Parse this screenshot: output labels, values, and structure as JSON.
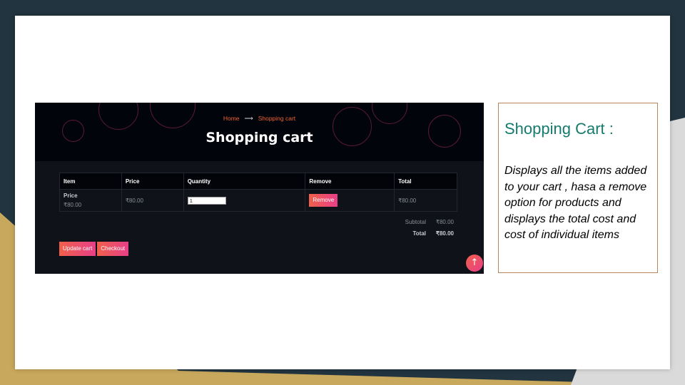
{
  "colors": {
    "background_dark": "#213440",
    "background_gold": "#c8a85c",
    "slide": "#ffffff",
    "hero": "#02040c",
    "accent_orange": "#f0622e",
    "button_gradient_start": "#f0604a",
    "button_gradient_end": "#e83f88",
    "title_teal": "#157b6e",
    "box_border": "#b8865a"
  },
  "screenshot": {
    "breadcrumb": {
      "home": "Home",
      "separator": "⟶",
      "current": "Shopping cart"
    },
    "title": "Shopping cart",
    "table": {
      "headers": [
        "Item",
        "Price",
        "Quantity",
        "Remove",
        "Total"
      ],
      "rows": [
        {
          "item_name": "Price",
          "item_price": "₹80.00",
          "price": "₹80.00",
          "quantity": "1",
          "remove_label": "Remove",
          "total": "₹80.00"
        }
      ]
    },
    "totals": {
      "subtotal_label": "Subtotal",
      "subtotal_value": "₹80.00",
      "total_label": "Total",
      "total_value": "₹80.00"
    },
    "buttons": {
      "update_cart": "Update cart",
      "checkout": "Checkout"
    },
    "scroll_top_icon": "↑"
  },
  "description": {
    "title": "Shopping Cart :",
    "body": "Displays all the items added to your cart , hasa a remove option for products and displays the total cost and cost of individual items"
  }
}
